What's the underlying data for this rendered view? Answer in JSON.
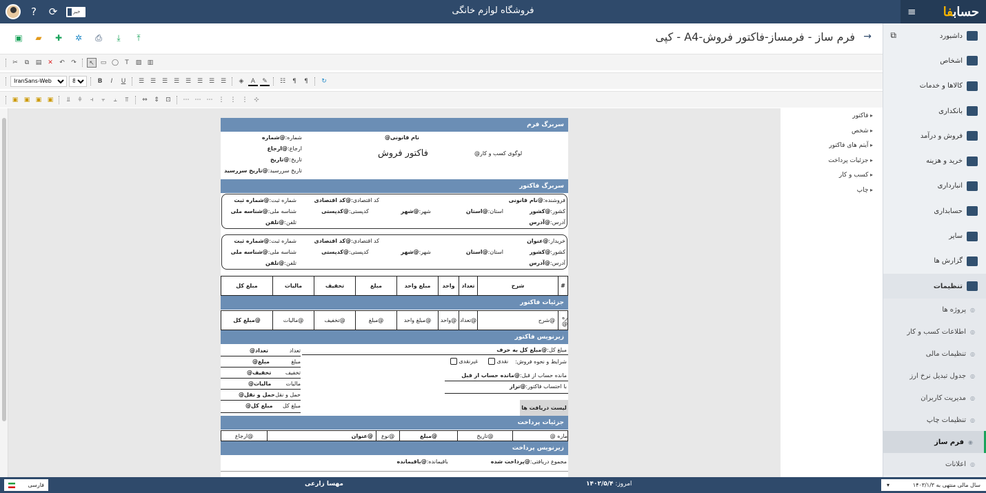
{
  "app": {
    "logo_main": "حساب",
    "logo_accent": "فا",
    "shop_title": "فروشگاه لوازم خانگی",
    "flag_label": "خبر"
  },
  "page": {
    "title": "فرم ساز - فرمساز-فاکتور فروش-A4 - کپی"
  },
  "sidebar": {
    "items": [
      {
        "label": "داشبورد"
      },
      {
        "label": "اشخاص"
      },
      {
        "label": "کالاها و خدمات"
      },
      {
        "label": "بانکداری"
      },
      {
        "label": "فروش و درآمد"
      },
      {
        "label": "خرید و هزینه"
      },
      {
        "label": "انبارداری"
      },
      {
        "label": "حسابداری"
      },
      {
        "label": "سایر"
      },
      {
        "label": "گزارش ها"
      },
      {
        "label": "تنظیمات"
      }
    ],
    "sub_items": [
      {
        "label": "پروژه ها"
      },
      {
        "label": "اطلاعات کسب و کار"
      },
      {
        "label": "تنظیمات مالی"
      },
      {
        "label": "جدول تبدیل نرخ ارز"
      },
      {
        "label": "مدیریت کاربران"
      },
      {
        "label": "تنظیمات چاپ"
      },
      {
        "label": "فرم ساز"
      },
      {
        "label": "اعلانات"
      }
    ]
  },
  "toolbar": {
    "font": "IranSans-Web",
    "size": "8"
  },
  "tree": [
    "فاکتور",
    "شخص",
    "آیتم های فاکتور",
    "جزئیات پرداخت",
    "کسب و کار",
    "چاپ"
  ],
  "doc": {
    "band_header": "سربرگ فرم",
    "legal_name": "@نام قانونی",
    "invoice_title": "فاکتور فروش",
    "logo_label": "@لوگوی کسب و کار",
    "num_label": "شماره:",
    "num_val": "@شماره",
    "ref_label": "ارجاع:",
    "ref_val": "@ارجاع",
    "date_label": "تاریخ:",
    "date_val": "@تاریخ",
    "due_label": "تاریخ سررسید:",
    "due_val": "@تاریخ سررسید",
    "band_invoice_header": "سربرگ فاکتور",
    "seller_label": "فروشنده:",
    "seller_val": "@نام قانونی",
    "buyer_label": "خریدار:",
    "buyer_val": "@عنوان",
    "econ_label": "کد اقتصادی:",
    "econ_val": "@کد اقتصادی",
    "reg_label": "شماره ثبت:",
    "reg_val": "@شماره ثبت",
    "country_label": "کشور:",
    "country_val": "@کشور",
    "province_label": "استان:",
    "province_val": "@استان",
    "city_label": "شهر:",
    "city_val": "@شهر",
    "postal_label": "کدپستی:",
    "postal_val": "@کدپستی",
    "nid_label": "شناسه ملی:",
    "nid_val": "@شناسه ملی",
    "address_label": "آدرس:",
    "address_val": "@آدرس",
    "phone_label": "تلفن:",
    "phone_val": "@تلفن",
    "columns": [
      "#",
      "شرح",
      "تعداد",
      "واحد",
      "مبلغ واحد",
      "مبلغ",
      "تخفیف",
      "مالیات",
      "مبلغ کل"
    ],
    "band_details": "جزئیات فاکتور",
    "row": [
      "ره @",
      "@شرح",
      "@تعداد",
      "@واحد",
      "@مبلغ واحد",
      "@مبلغ",
      "@تخفیف",
      "@مالیات",
      "@مبلغ کل"
    ],
    "band_footer": "زیرنویس فاکتور",
    "total_words_label": "مبلغ کل:",
    "total_words_val": "@مبلغ کل به حرف",
    "terms_label": "شرایط و نحوه فروش:",
    "cash": "نقدی",
    "noncash": "غیرنقدی",
    "prev_label": "مانده حساب از قبل:",
    "prev_val": "@مانده حساب از قبل",
    "balance_label": "با احتساب فاکتور:",
    "balance_val": "@تراز",
    "receipts_label": "لیست دریافت ها",
    "totals": [
      {
        "label": "تعداد",
        "val": "@تعداد"
      },
      {
        "label": "مبلغ",
        "val": "@مبلغ"
      },
      {
        "label": "تخفیف",
        "val": "@تخفیف"
      },
      {
        "label": "مالیات",
        "val": "@مالیات"
      },
      {
        "label": "حمل و نقل",
        "val": "@حمل و نقل"
      },
      {
        "label": "مبلغ کل",
        "val": "@مبلغ کل"
      }
    ],
    "band_payment": "جزئیات پرداخت",
    "pay_row": [
      "ماره @",
      "@تاریخ",
      "@مبلغ",
      "@نوع",
      "@عنوان",
      "@ارجاع"
    ],
    "band_pay_footer": "زیرنویس پرداخت",
    "received_label": "مجموع دریافتی:",
    "received_val": "@پرداخت شده",
    "remain_label": "باقیمانده:",
    "remain_val": "@باقیمانده"
  },
  "status": {
    "user": "مهسا زارعی",
    "today_label": "امروز:",
    "today_val": "۱۴۰۲/۵/۴",
    "lang": "فارسی",
    "fiscal": "سال مالی منتهی به ۱۴۰۳/۱/۳"
  }
}
